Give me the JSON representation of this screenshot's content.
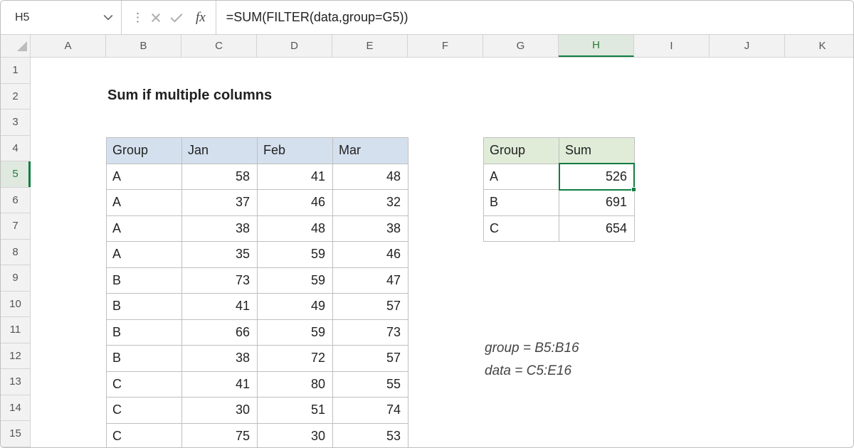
{
  "name_box": "H5",
  "formula": "=SUM(FILTER(data,group=G5))",
  "columns": [
    "A",
    "B",
    "C",
    "D",
    "E",
    "F",
    "G",
    "H",
    "I",
    "J",
    "K"
  ],
  "active_col_index": 7,
  "rows": [
    "1",
    "2",
    "3",
    "4",
    "5",
    "6",
    "7",
    "8",
    "9",
    "10",
    "11",
    "12",
    "13",
    "14",
    "15"
  ],
  "active_row_index": 4,
  "title": "Sum if multiple columns",
  "main_table": {
    "headers": [
      "Group",
      "Jan",
      "Feb",
      "Mar"
    ],
    "rows": [
      [
        "A",
        "58",
        "41",
        "48"
      ],
      [
        "A",
        "37",
        "46",
        "32"
      ],
      [
        "A",
        "38",
        "48",
        "38"
      ],
      [
        "A",
        "35",
        "59",
        "46"
      ],
      [
        "B",
        "73",
        "59",
        "47"
      ],
      [
        "B",
        "41",
        "49",
        "57"
      ],
      [
        "B",
        "66",
        "59",
        "73"
      ],
      [
        "B",
        "38",
        "72",
        "57"
      ],
      [
        "C",
        "41",
        "80",
        "55"
      ],
      [
        "C",
        "30",
        "51",
        "74"
      ],
      [
        "C",
        "75",
        "30",
        "53"
      ]
    ]
  },
  "sum_table": {
    "headers": [
      "Group",
      "Sum"
    ],
    "rows": [
      [
        "A",
        "526"
      ],
      [
        "B",
        "691"
      ],
      [
        "C",
        "654"
      ]
    ]
  },
  "notes": {
    "line1": "group = B5:B16",
    "line2": "data = C5:E16"
  }
}
